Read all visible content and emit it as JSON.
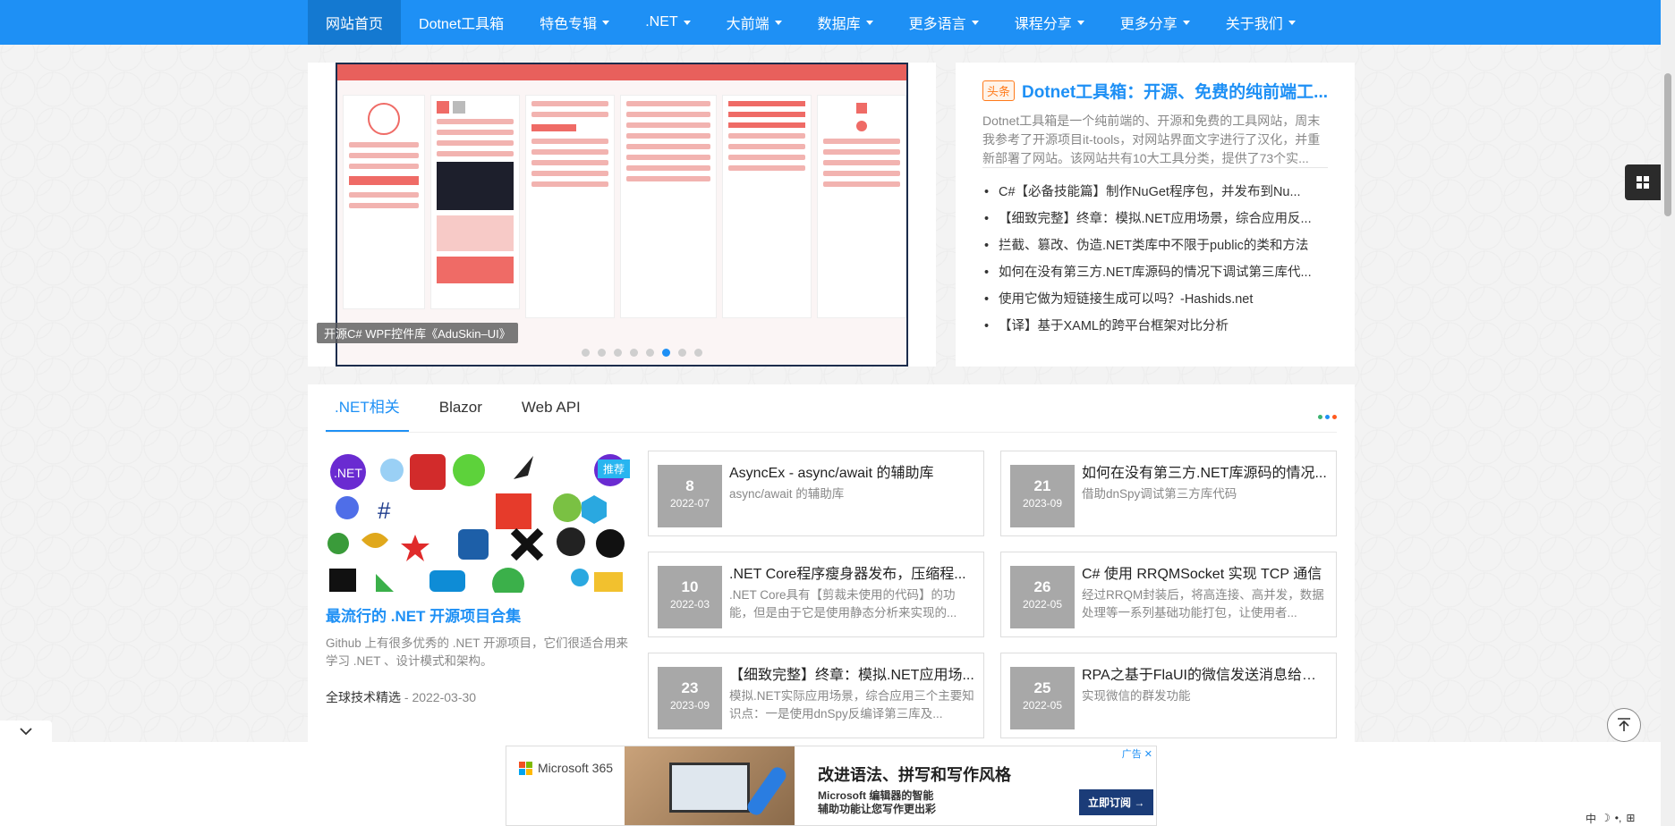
{
  "nav": {
    "items": [
      {
        "label": "网站首页",
        "dropdown": false,
        "active": true
      },
      {
        "label": "Dotnet工具箱",
        "dropdown": false
      },
      {
        "label": "特色专辑",
        "dropdown": true
      },
      {
        "label": ".NET",
        "dropdown": true
      },
      {
        "label": "大前端",
        "dropdown": true
      },
      {
        "label": "数据库",
        "dropdown": true
      },
      {
        "label": "更多语言",
        "dropdown": true
      },
      {
        "label": "课程分享",
        "dropdown": true
      },
      {
        "label": "更多分享",
        "dropdown": true
      },
      {
        "label": "关于我们",
        "dropdown": true
      }
    ]
  },
  "carousel": {
    "caption": "开源C# WPF控件库《AduSkin–UI》",
    "slide_count": 8,
    "active_index": 5
  },
  "headline": {
    "badge": "头条",
    "title": "Dotnet工具箱：开源、免费的纯前端工...",
    "summary": "Dotnet工具箱是一个纯前端的、开源和免费的工具网站，周末我参考了开源项目it-tools，对网站界面文字进行了汉化，并重新部署了网站。该网站共有10大工具分类，提供了73个实...",
    "list": [
      "C#【必备技能篇】制作NuGet程序包，并发布到Nu...",
      "【细致完整】终章：模拟.NET应用场景，综合应用反...",
      "拦截、篡改、伪造.NET类库中不限于public的类和方法",
      "如何在没有第三方.NET库源码的情况下调试第三库代...",
      "使用它做为短链接生成可以吗？-Hashids.net",
      "【译】基于XAML的跨平台框架对比分析"
    ]
  },
  "tabs": {
    "items": [
      ".NET相关",
      "Blazor",
      "Web API"
    ],
    "active": 0
  },
  "feature": {
    "badge": "推荐",
    "title": "最流行的 .NET 开源项目合集",
    "desc": "Github 上有很多优秀的 .NET 开源项目，它们很适合用来学习 .NET 、设计模式和架构。",
    "author": "全球技术精选",
    "date": " - 2022-03-30"
  },
  "articles": [
    {
      "day": "8",
      "ym": "2022-07",
      "title": "AsyncEx - async/await 的辅助库",
      "desc": "async/await 的辅助库"
    },
    {
      "day": "21",
      "ym": "2023-09",
      "title": "如何在没有第三方.NET库源码的情况...",
      "desc": "借助dnSpy调试第三方库代码"
    },
    {
      "day": "10",
      "ym": "2022-03",
      "title": ".NET Core程序瘦身器发布，压缩程...",
      "desc": ".NET Core具有【剪裁未使用的代码】的功能，但是由于它是使用静态分析来实现的..."
    },
    {
      "day": "26",
      "ym": "2022-05",
      "title": "C# 使用 RRQMSocket 实现 TCP 通信",
      "desc": "经过RRQM封装后，将高连接、高并发，数据处理等一系列基础功能打包，让使用者..."
    },
    {
      "day": "23",
      "ym": "2023-09",
      "title": "【细致完整】终章：模拟.NET应用场...",
      "desc": "模拟.NET实际应用场景，综合应用三个主要知识点：一是使用dnSpy反编译第三库及..."
    },
    {
      "day": "25",
      "ym": "2022-05",
      "title": "RPA之基于FlaUI的微信发送消息给某...",
      "desc": "实现微信的群发功能"
    }
  ],
  "ad": {
    "brand": "Microsoft 365",
    "headline": "改进语法、拼写和写作风格",
    "sub1": "Microsoft 编辑器的智能",
    "sub2": "辅助功能让您写作更出彩",
    "cta": "立即订阅 →",
    "tag": "广告",
    "close": "✕"
  },
  "ime": {
    "items": [
      "中",
      "☽",
      "•,",
      "⊞"
    ]
  },
  "colors": {
    "primary": "#1e90f5",
    "nav_active": "#1479d1",
    "date_box": "#a8a8a8",
    "badge_orange": "#ff7a1a"
  },
  "icons": {
    "side_float": "grid-icon",
    "back_top": "arrow-up-icon",
    "collapse": "chevron-down-icon"
  }
}
